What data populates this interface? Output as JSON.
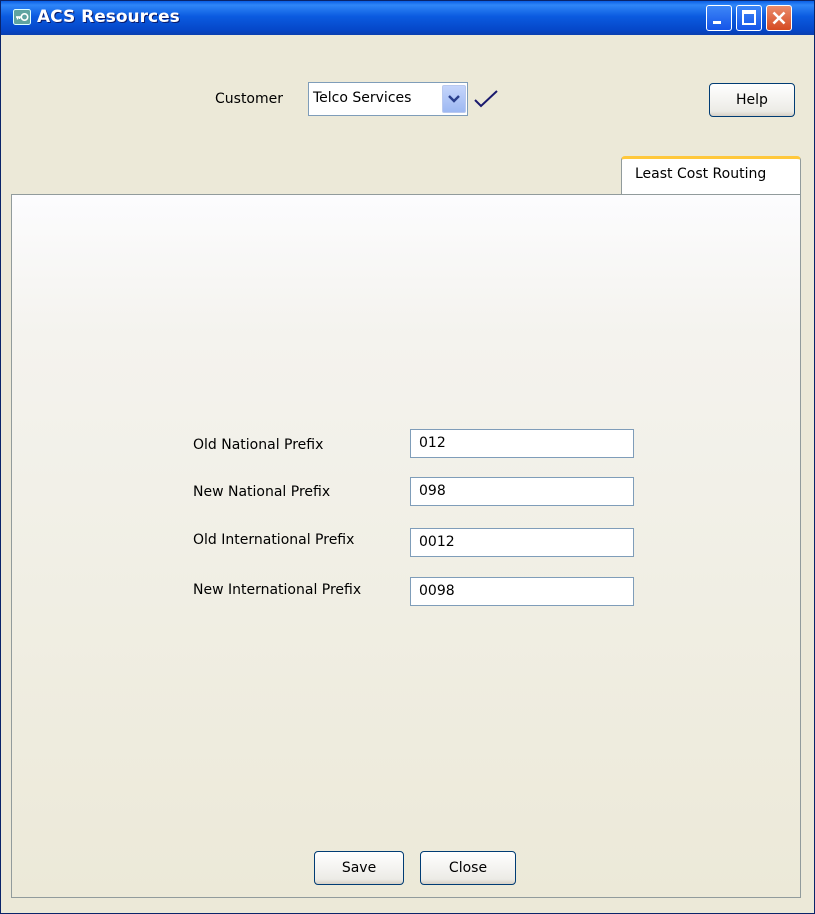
{
  "window": {
    "title": "ACS Resources"
  },
  "header": {
    "customer_label": "Customer",
    "customer_value": "Telco Services",
    "help_label": "Help"
  },
  "tabs": [
    {
      "label": "Least Cost Routing",
      "active": true
    }
  ],
  "form": {
    "fields": [
      {
        "label": "Old National Prefix",
        "value": "012"
      },
      {
        "label": "New National Prefix",
        "value": "098"
      },
      {
        "label": "Old International Prefix",
        "value": "0012"
      },
      {
        "label": "New International Prefix",
        "value": "0098"
      }
    ]
  },
  "footer": {
    "save_label": "Save",
    "close_label": "Close"
  },
  "icons": {
    "app": "key-icon",
    "titlebar": [
      "minimize-icon",
      "maximize-icon",
      "close-icon"
    ],
    "customer_dropdown": "chevron-down-icon",
    "validate": "checkmark-icon"
  },
  "colors": {
    "titlebar": "#0a5fe6",
    "window_bg": "#ece9d8",
    "tab_accent": "#ffc83c",
    "close_button": "#d54a22",
    "checkmark": "#1a1a6e"
  }
}
